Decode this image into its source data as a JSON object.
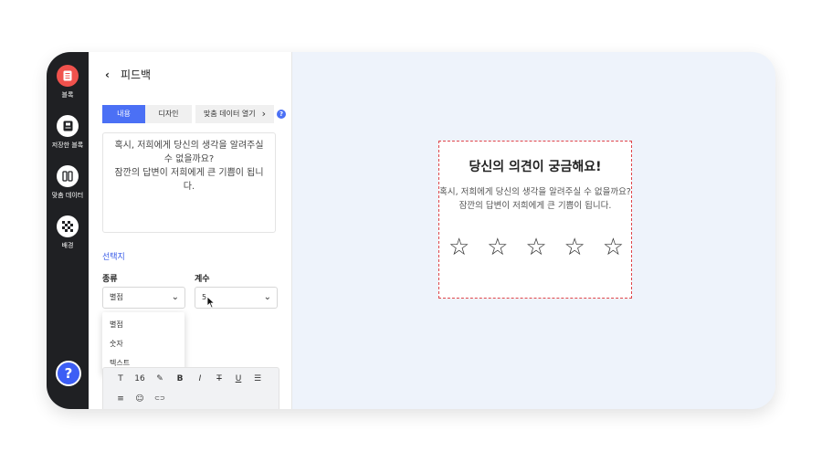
{
  "sidebar": {
    "items": [
      {
        "label": "블록",
        "icon": "document-icon",
        "active": true
      },
      {
        "label": "저장한 블록",
        "icon": "saved-block-icon",
        "active": false
      },
      {
        "label": "맞춤 데이터",
        "icon": "custom-data-icon",
        "active": false
      },
      {
        "label": "배경",
        "icon": "checker-background-icon",
        "active": false
      }
    ],
    "help_label": "?"
  },
  "panel": {
    "back_label": "피드백",
    "tabs": [
      {
        "label": "내용",
        "active": true
      },
      {
        "label": "디자인",
        "active": false
      },
      {
        "label": "맞춤 데이터 열기",
        "active": false
      }
    ],
    "content_lines": [
      "혹시, 저희에게 당신의 생각을 알려주실",
      "수 없을까요?",
      "잠깐의 답변이 저희에게 큰 기쁨이 됩니",
      "다."
    ],
    "section_label": "선택지",
    "type_label": "종류",
    "type_value": "별점",
    "count_label": "계수",
    "count_value": "5",
    "dropdown_options": [
      "별점",
      "숫자",
      "텍스트"
    ],
    "toolbar_row1": [
      "T",
      "16",
      "✎",
      "B",
      "I",
      "T",
      "U",
      "☰"
    ],
    "toolbar_row2": [
      "≡",
      "☺",
      "⊂⊃"
    ]
  },
  "preview": {
    "title": "당신의 의견이 궁금해요!",
    "desc_line1": "혹시, 저희에게 당신의 생각을 알려주실 수 없을까요?",
    "desc_line2": "잠깐의 답변이 저희에게 큰 기쁨이 됩니다.",
    "star_count": 5,
    "star_glyph": "☆"
  },
  "colors": {
    "accent": "#4b70f5",
    "active_rail": "#f0524d",
    "rail_bg": "#1f2023",
    "canvas_bg": "#eef3fb",
    "card_border": "#e0454a"
  }
}
